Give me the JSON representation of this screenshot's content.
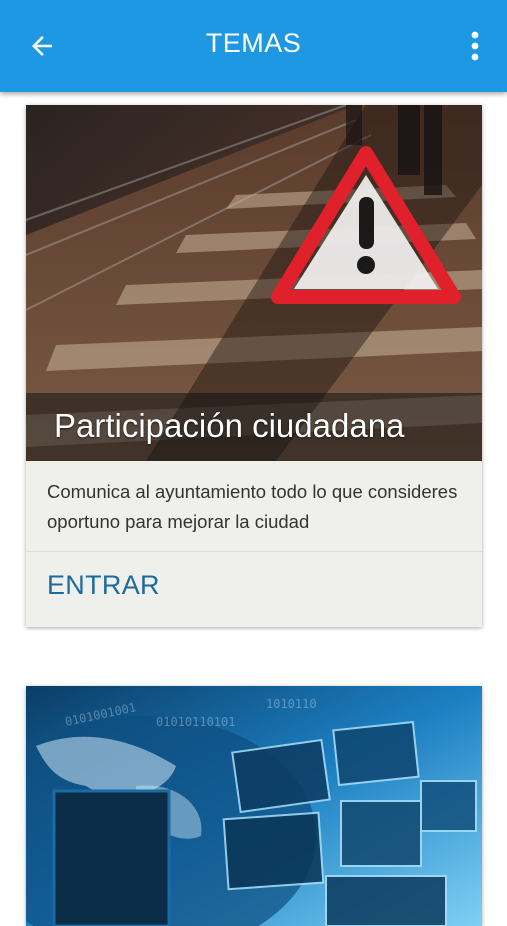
{
  "appbar": {
    "title": "TEMAS",
    "back_icon": "arrow-left-icon",
    "menu_icon": "more-vertical-icon",
    "background": "#1e98e3"
  },
  "cards": [
    {
      "title": "Participación ciudadana",
      "description": "Comunica al ayuntamiento todo lo que consideres oportuno para mejorar la ciudad",
      "action": "ENTRAR",
      "image_icon": "warning-triangle-icon"
    },
    {
      "image_icon": "globe-screens-image"
    }
  ],
  "colors": {
    "accent": "#1d6a9e",
    "warning": "#e0202a",
    "card_bg": "#efefec"
  }
}
